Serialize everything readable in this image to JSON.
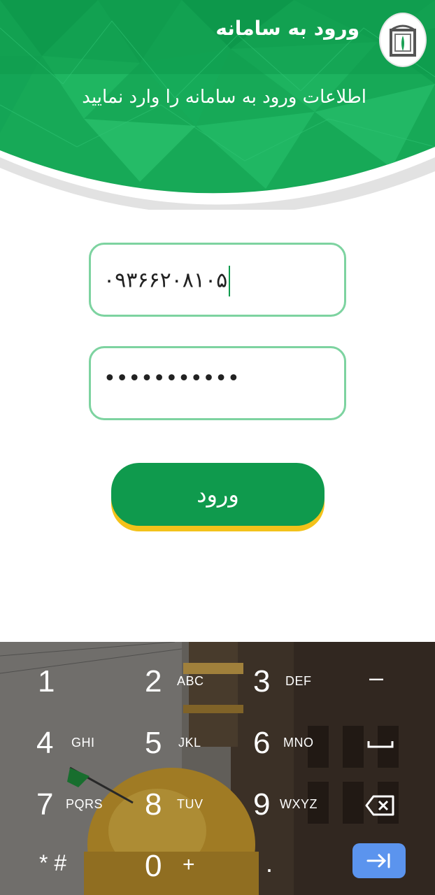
{
  "header": {
    "title": "ورود به سامانه",
    "subtitle": "اطلاعات ورود به سامانه را وارد نمایید",
    "logo_icon": "shrine-logo-icon",
    "colors": {
      "green": "#0e9a4d",
      "light_green": "#22b35e"
    }
  },
  "form": {
    "phone_value": "۰۹۳۶۶۲۰۸۱۰۵",
    "password_mask": "•••••••••••",
    "login_label": "ورود",
    "colors": {
      "field_border": "#7dd3a0",
      "button": "#0f9a4d",
      "button_shadow": "#f3c21a"
    }
  },
  "keyboard": {
    "rows": [
      [
        {
          "num": "1",
          "letters": ""
        },
        {
          "num": "2",
          "letters": "ABC"
        },
        {
          "num": "3",
          "letters": "DEF"
        },
        {
          "num": "–",
          "letters": ""
        }
      ],
      [
        {
          "num": "4",
          "letters": "GHI"
        },
        {
          "num": "5",
          "letters": "JKL"
        },
        {
          "num": "6",
          "letters": "MNO"
        },
        {
          "num": "␣",
          "letters": ""
        }
      ],
      [
        {
          "num": "7",
          "letters": "PQRS"
        },
        {
          "num": "8",
          "letters": "TUV"
        },
        {
          "num": "9",
          "letters": "WXYZ"
        },
        {
          "num": "⌫",
          "letters": ""
        }
      ],
      [
        {
          "num": "* #",
          "letters": ""
        },
        {
          "num": "0",
          "letters": "+"
        },
        {
          "num": ".",
          "letters": ""
        },
        {
          "num": "→|",
          "letters": ""
        }
      ]
    ],
    "enter_color": "#5b94ee"
  }
}
